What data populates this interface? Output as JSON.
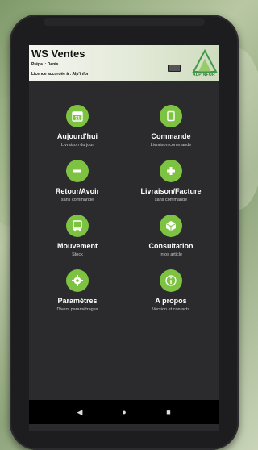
{
  "app": {
    "title": "WS Ventes",
    "prepa": "Prépa. : Denis",
    "licence": "Licence accordée à : Alp'infor",
    "logo_text": "ALPINFOR"
  },
  "menu": [
    {
      "title": "Aujourd'hui",
      "sub": "Livraison du jour",
      "icon": "calendar-icon"
    },
    {
      "title": "Commande",
      "sub": "Livraison commande",
      "icon": "document-icon"
    },
    {
      "title": "Retour/Avoir",
      "sub": "sans commande",
      "icon": "minus-icon"
    },
    {
      "title": "Livraison/Facture",
      "sub": "sans commande",
      "icon": "plus-icon"
    },
    {
      "title": "Mouvement",
      "sub": "Stock",
      "icon": "cart-icon"
    },
    {
      "title": "Consultation",
      "sub": "Infos article",
      "icon": "cube-icon"
    },
    {
      "title": "Paramètres",
      "sub": "Divers paramétrages",
      "icon": "gear-icon"
    },
    {
      "title": "A propos",
      "sub": "Version et contacts",
      "icon": "info-icon"
    }
  ],
  "calendar_day": "31",
  "nav": {
    "back": "◀",
    "home": "●",
    "recent": "■"
  },
  "colors": {
    "accent": "#7ec242",
    "screen_bg": "#2b2b2e",
    "nav_bg": "#000000"
  }
}
